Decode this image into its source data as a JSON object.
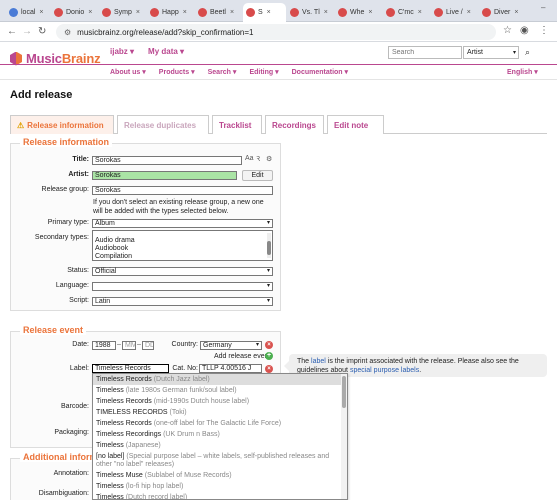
{
  "browser": {
    "tabs": [
      {
        "label": "local",
        "color": "#4a7bd6"
      },
      {
        "label": "Donio",
        "color": "#d84b4b"
      },
      {
        "label": "Symp",
        "color": "#d84b4b"
      },
      {
        "label": "Happ",
        "color": "#d84b4b"
      },
      {
        "label": "Beetl",
        "color": "#d84b4b"
      },
      {
        "label": "S",
        "color": "#d84b4b"
      },
      {
        "label": "Vs. Tl",
        "color": "#d84b4b"
      },
      {
        "label": "Whe",
        "color": "#d84b4b"
      },
      {
        "label": "C'mc",
        "color": "#d84b4b"
      },
      {
        "label": "Live /",
        "color": "#d84b4b"
      },
      {
        "label": "Diver",
        "color": "#d84b4b"
      }
    ],
    "url": "musicbrainz.org/release/add?skip_confirmation=1"
  },
  "header": {
    "logo_music": "Music",
    "logo_brainz": "Brainz",
    "user": "ijabz",
    "user_menu": "My data",
    "search_placeholder": "Search",
    "search_type": "Artist",
    "nav": [
      "About us",
      "Products",
      "Search",
      "Editing",
      "Documentation"
    ],
    "language": "English"
  },
  "page_title": "Add release",
  "tabs": [
    {
      "label": "Release information",
      "state": "active"
    },
    {
      "label": "Release duplicates",
      "state": "disabled"
    },
    {
      "label": "Tracklist",
      "state": "normal"
    },
    {
      "label": "Recordings",
      "state": "normal"
    },
    {
      "label": "Edit note",
      "state": "normal"
    }
  ],
  "release_info": {
    "legend": "Release information",
    "title_label": "Title:",
    "title_value": "Sorokas",
    "artist_label": "Artist:",
    "artist_value": "Sorokas",
    "edit_button": "Edit",
    "group_label": "Release group:",
    "group_value": "Sorokas",
    "group_note": "If you don't select an existing release group, a new one will be added with the types selected below.",
    "primary_label": "Primary type:",
    "primary_value": "Album",
    "secondary_label": "Secondary types:",
    "secondary_options": [
      "Audio drama",
      "Audiobook",
      "Compilation"
    ],
    "status_label": "Status:",
    "status_value": "Official",
    "language_label": "Language:",
    "language_value": "",
    "script_label": "Script:",
    "script_value": "Latin"
  },
  "release_event": {
    "legend": "Release event",
    "date_label": "Date:",
    "year": "1988",
    "month_placeholder": "MM",
    "day_placeholder": "DD",
    "country_label": "Country:",
    "country_value": "Germany",
    "add_event": "Add release event",
    "label_label": "Label:",
    "label_value": "Timeless Records",
    "catno_label": "Cat. No:",
    "catno_value": "TLLP 4.00516 J",
    "barcode_label": "Barcode:",
    "packaging_label": "Packaging:"
  },
  "additional": {
    "legend": "Additional inform",
    "annotation_label": "Annotation:",
    "disambiguation_label": "Disambiguation:"
  },
  "tooltip": {
    "pre": "The ",
    "link1": "label",
    "mid": " is the imprint associated with the release. Please also see the guidelines about ",
    "link2": "special purpose labels",
    "post": "."
  },
  "dropdown": [
    {
      "name": "Timeless Records",
      "comment": "(Dutch Jazz label)"
    },
    {
      "name": "Timeless",
      "comment": "(late 1980s German funk/soul label)"
    },
    {
      "name": "Timeless Records",
      "comment": "(mid-1990s Dutch house label)"
    },
    {
      "name": "TIMELESS RECORDS",
      "comment": "(Toki)"
    },
    {
      "name": "Timeless Records",
      "comment": "(one-off label for The Galactic Life Force)"
    },
    {
      "name": "Timeless Recordings",
      "comment": "(UK Drum n Bass)"
    },
    {
      "name": "Timeless",
      "comment": "(Japanese)"
    },
    {
      "name": "[no label]",
      "comment": "(Special purpose label – white labels, self-published releases and other \"no label\" releases)"
    },
    {
      "name": "Timeless Muse",
      "comment": "(Sublabel of Muse Records)"
    },
    {
      "name": "Timeless",
      "comment": "(lo-fi hip hop label)"
    },
    {
      "name": "Timeless",
      "comment": "(Dutch record label)"
    }
  ]
}
